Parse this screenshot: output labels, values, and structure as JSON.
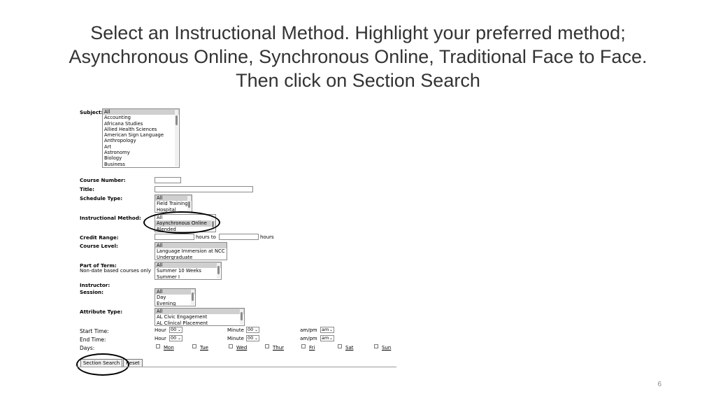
{
  "slide": {
    "title_lines": [
      "Select an Instructional Method. Highlight your preferred method;",
      "Asynchronous Online, Synchronous Online, Traditional Face to Face.",
      "Then click on Section Search"
    ],
    "page_number": "6"
  },
  "form": {
    "subject": {
      "label": "Subject:",
      "options": [
        "All",
        "Accounting",
        "Africana Studies",
        "Allied Health Sciences",
        "American Sign Language",
        "Anthropology",
        "Art",
        "Astronomy",
        "Biology",
        "Business"
      ]
    },
    "course_number": {
      "label": "Course Number:",
      "value": ""
    },
    "title": {
      "label": "Title:",
      "value": ""
    },
    "schedule_type": {
      "label": "Schedule Type:",
      "options": [
        "All",
        "Field Training",
        "Hospital"
      ]
    },
    "instructional_method": {
      "label": "Instructional Method:",
      "options": [
        "All",
        "Asynchronous Online",
        "Blended"
      ]
    },
    "credit_range": {
      "label": "Credit Range:",
      "from_value": "",
      "middle_text": "hours to",
      "to_value": "",
      "suffix": "hours"
    },
    "course_level": {
      "label": "Course Level:",
      "options": [
        "All",
        "Language Immersion at NCC",
        "Undergraduate"
      ]
    },
    "part_of_term": {
      "label": "Part of Term:",
      "note": "Non-date based courses only",
      "options": [
        "All",
        "Summer 10 Weeks",
        "Summer I"
      ]
    },
    "instructor": {
      "label": "Instructor:"
    },
    "session": {
      "label": "Session:",
      "options": [
        "All",
        "Day",
        "Evening"
      ]
    },
    "attribute_type": {
      "label": "Attribute Type:",
      "options": [
        "All",
        "AL Civic Engagement",
        "AL Clinical Placement"
      ]
    },
    "start_time": {
      "label": "Start Time:",
      "hour_label": "Hour",
      "hour_value": "00",
      "minute_label": "Minute",
      "minute_value": "00",
      "ampm_label": "am/pm",
      "ampm_value": "am"
    },
    "end_time": {
      "label": "End Time:",
      "hour_label": "Hour",
      "hour_value": "00",
      "minute_label": "Minute",
      "minute_value": "00",
      "ampm_label": "am/pm",
      "ampm_value": "am"
    },
    "days": {
      "label": "Days:",
      "items": [
        "Mon",
        "Tue",
        "Wed",
        "Thur",
        "Fri",
        "Sat",
        "Sun"
      ]
    },
    "buttons": {
      "section_search": "Section Search",
      "reset": "Reset"
    }
  }
}
